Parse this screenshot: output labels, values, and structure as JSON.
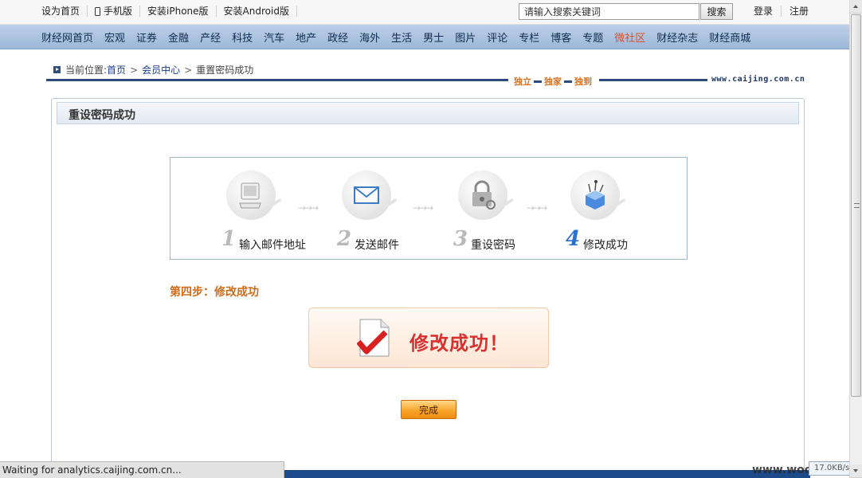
{
  "topbar": {
    "links": [
      "设为首页",
      "手机版",
      "安装iPhone版",
      "安装Android版"
    ],
    "search": {
      "value": "请输入搜索关键词",
      "button": "搜索"
    },
    "auth": [
      "登录",
      "注册"
    ]
  },
  "nav": {
    "items": [
      "财经网首页",
      "宏观",
      "证券",
      "金融",
      "产经",
      "科技",
      "汽车",
      "地产",
      "政经",
      "海外",
      "生活",
      "男士",
      "图片",
      "评论",
      "专栏",
      "博客",
      "专题",
      "微社区",
      "财经杂志",
      "财经商城"
    ],
    "highlight_color": "#e0502a"
  },
  "breadcrumb": {
    "prefix": "当前位置:",
    "home": "首页",
    "member": "会员中心",
    "current": "重置密码成功",
    "separator": ">"
  },
  "slogan": [
    "独立",
    "独家",
    "独到"
  ],
  "site_url": "www.caijing.com.cn",
  "panel": {
    "title": "重设密码成功",
    "steps": [
      {
        "num": "1",
        "label": "输入邮件地址",
        "icon": "computer-icon"
      },
      {
        "num": "2",
        "label": "发送邮件",
        "icon": "envelope-icon"
      },
      {
        "num": "3",
        "label": "重设密码",
        "icon": "lock-key-icon"
      },
      {
        "num": "4",
        "label": "修改成功",
        "icon": "gift-box-icon"
      }
    ],
    "step_title": "第四步：修改成功",
    "success_text": "修改成功！",
    "done_button": "完成"
  },
  "status": {
    "text": "Waiting for analytics.caijing.com.cn...",
    "speed": "17.0KB/s"
  },
  "watermark": "www.wooyun.org",
  "colors": {
    "nav_bg": "#a9c0de",
    "accent_orange": "#d06a17",
    "success_red": "#d93030"
  }
}
